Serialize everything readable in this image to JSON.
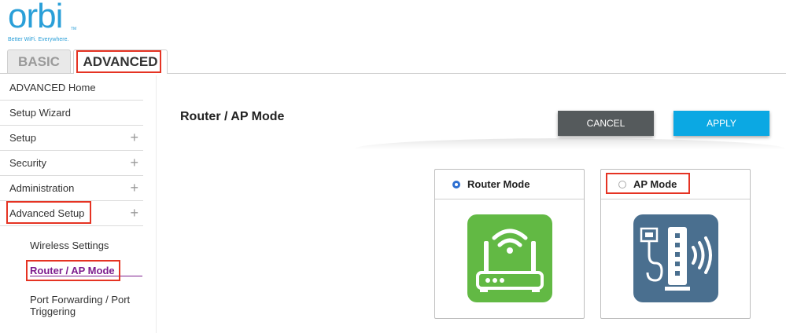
{
  "header": {
    "logo_text": "orbi",
    "logo_tm": "TM",
    "tagline": "Better WiFi. Everywhere."
  },
  "tabs": [
    {
      "label": "BASIC"
    },
    {
      "label": "ADVANCED"
    }
  ],
  "sidebar": {
    "items": [
      {
        "label": "ADVANCED Home"
      },
      {
        "label": "Setup Wizard"
      },
      {
        "label": "Setup",
        "expand": "+"
      },
      {
        "label": "Security",
        "expand": "+"
      },
      {
        "label": "Administration",
        "expand": "+"
      },
      {
        "label": "Advanced Setup",
        "expand": "+"
      }
    ],
    "subitems": [
      {
        "label": "Wireless Settings"
      },
      {
        "label": "Router / AP Mode"
      },
      {
        "label": "Port Forwarding / Port Triggering"
      }
    ]
  },
  "main": {
    "title": "Router / AP Mode",
    "cancel_label": "CANCEL",
    "apply_label": "APPLY",
    "modes": [
      {
        "label": "Router Mode",
        "selected": true,
        "icon": "router-icon",
        "color": "#62b944"
      },
      {
        "label": "AP Mode",
        "selected": false,
        "icon": "access-point-icon",
        "color": "#4a6f8f"
      }
    ]
  },
  "colors": {
    "brand": "#2a9fd8",
    "highlight": "#e53323",
    "active_link": "#7d1d8e",
    "apply": "#0ba8e3",
    "cancel": "#555a5c"
  }
}
